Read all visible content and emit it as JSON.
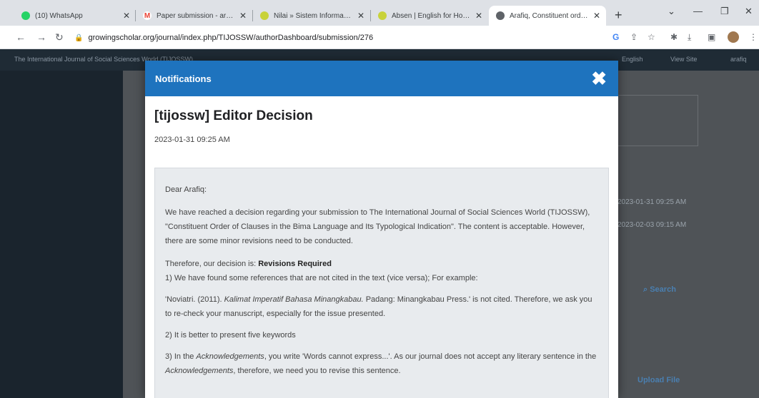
{
  "browser": {
    "tabs": [
      {
        "title": "(10) WhatsApp",
        "color": "#25d366",
        "glyph": "10"
      },
      {
        "title": "Paper submission - arafiq@...",
        "color": "#ea4335",
        "glyph": "M"
      },
      {
        "title": "Nilai » Sistem Informasi A...",
        "color": "#8a9a2a",
        "glyph": "●"
      },
      {
        "title": "Absen | English for Hotel ...",
        "color": "#8a9a2a",
        "glyph": "●"
      },
      {
        "title": "Arafiq, Constituent order ...",
        "color": "#5f6368",
        "glyph": "◉"
      }
    ],
    "new_tab": "+",
    "address": "growingscholar.org/journal/index.php/TIJOSSW/authorDashboard/submission/276"
  },
  "site": {
    "journal_title": "The International Journal of Social Sciences World (TIJOSSW)",
    "nav_language": "English",
    "nav_view_site": "View Site",
    "nav_user": "arafiq",
    "date_1": "2023-01-31 09:25 AM",
    "date_2": "2023-02-03 09:15 AM",
    "search_label": "Search",
    "upload_label": "Upload File"
  },
  "modal": {
    "header": "Notifications",
    "close_glyph": "✖",
    "title": "[tijossw] Editor Decision",
    "date": "2023-01-31 09:25 AM",
    "greeting": "Dear Arafiq:",
    "para1": "We have reached a decision regarding your submission to The International Journal of Social Sciences World (TIJOSSW), \"Constituent Order of Clauses in the Bima Language and Its Typological Indication\". The content is acceptable. However, there are some minor revisions need to be conducted.",
    "decision_prefix": "Therefore, our decision is: ",
    "decision": "Revisions Required",
    "point1": "1) We have found some references that are not cited in the text (vice versa); For example:",
    "ref_a": "'Noviatri. (2011). ",
    "ref_title": "Kalimat Imperatif Bahasa Minangkabau.",
    "ref_b": " Padang: Minangkabau Press.' is not cited. Therefore, we ask you to re-check your manuscript, especially for the issue presented.",
    "point2": "2) It is better to present five keywords",
    "point3_a": "3) In the ",
    "point3_ack1": "Acknowledgements",
    "point3_b": ", you write 'Words cannot express...'. As our journal does not accept any literary sentence in the ",
    "point3_ack2": "Acknowledgements",
    "point3_c": ", therefore, we need you to revise this sentence."
  }
}
